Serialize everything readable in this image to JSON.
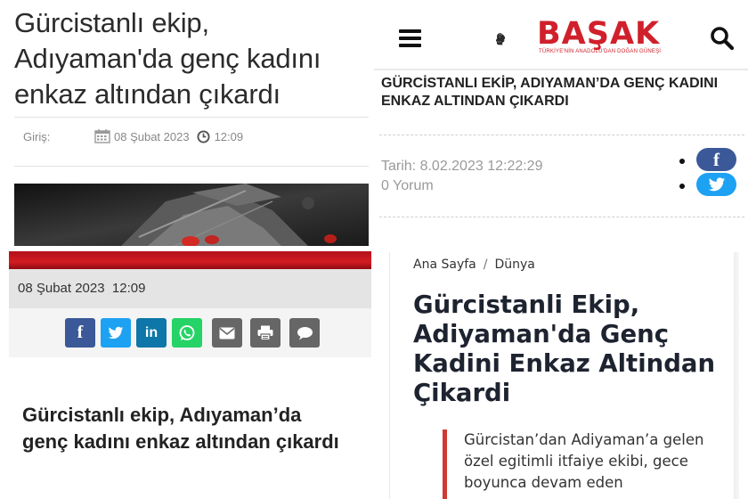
{
  "panel_1": {
    "title": "Gürcistanlı ekip, Adıyaman'da genç kadını enkaz altından çıkardı",
    "meta": {
      "label": "Giriş:",
      "date": "08 Şubat 2023",
      "time": "12:09"
    }
  },
  "panel_2": {
    "date_time": "08 Şubat 2023  12:09",
    "share_buttons": [
      {
        "network": "facebook",
        "icon": "f",
        "color": "#3b5998"
      },
      {
        "network": "twitter",
        "icon": "twitter-bird-icon",
        "color": "#1da1f2"
      },
      {
        "network": "linkedin",
        "icon": "in",
        "color": "#0e76a8"
      },
      {
        "network": "whatsapp",
        "icon": "whatsapp-icon",
        "color": "#25d366"
      },
      {
        "network": "email",
        "icon": "envelope-icon",
        "color": "#666666"
      },
      {
        "network": "print",
        "icon": "printer-icon",
        "color": "#666666"
      },
      {
        "network": "comment",
        "icon": "speech-bubble-icon",
        "color": "#666666"
      }
    ],
    "title": "Gürcistanlı ekip, Adıyaman’da genç kadını enkaz altından çıkardı"
  },
  "panel_3": {
    "brand": "BAŞAK",
    "slogan": "TÜRKİYE'NİN ANADOLU'DAN DOĞAN GÜNEŞİ",
    "title": "GÜRCİSTANLI EKİP, ADIYAMAN’DA GENÇ KADINI ENKAZ ALTINDAN ÇIKARDI",
    "date": "Tarih: 8.02.2023 12:22:29",
    "comments": "0 Yorum",
    "social": [
      {
        "network": "facebook",
        "icon": "f",
        "color": "#3b5998"
      },
      {
        "network": "twitter",
        "icon": "twitter-bird-icon",
        "color": "#1da1f2"
      }
    ]
  },
  "panel_4": {
    "breadcrumb": [
      "Ana Sayfa",
      "/",
      "Dünya"
    ],
    "title": "Gürcistanli Ekip, Adiyaman'da Genç Kadini Enkaz Altindan Çikardi",
    "summary": "Gürcistan’dan Adiyaman’a gelen özel egitimli itfaiye ekibi, gece boyunca devam eden"
  },
  "colors": {
    "brand_red": "#d0202b",
    "quote_bar": "#cd3a30",
    "red_banner": "#c4161f",
    "meta_gray": "#888888"
  }
}
